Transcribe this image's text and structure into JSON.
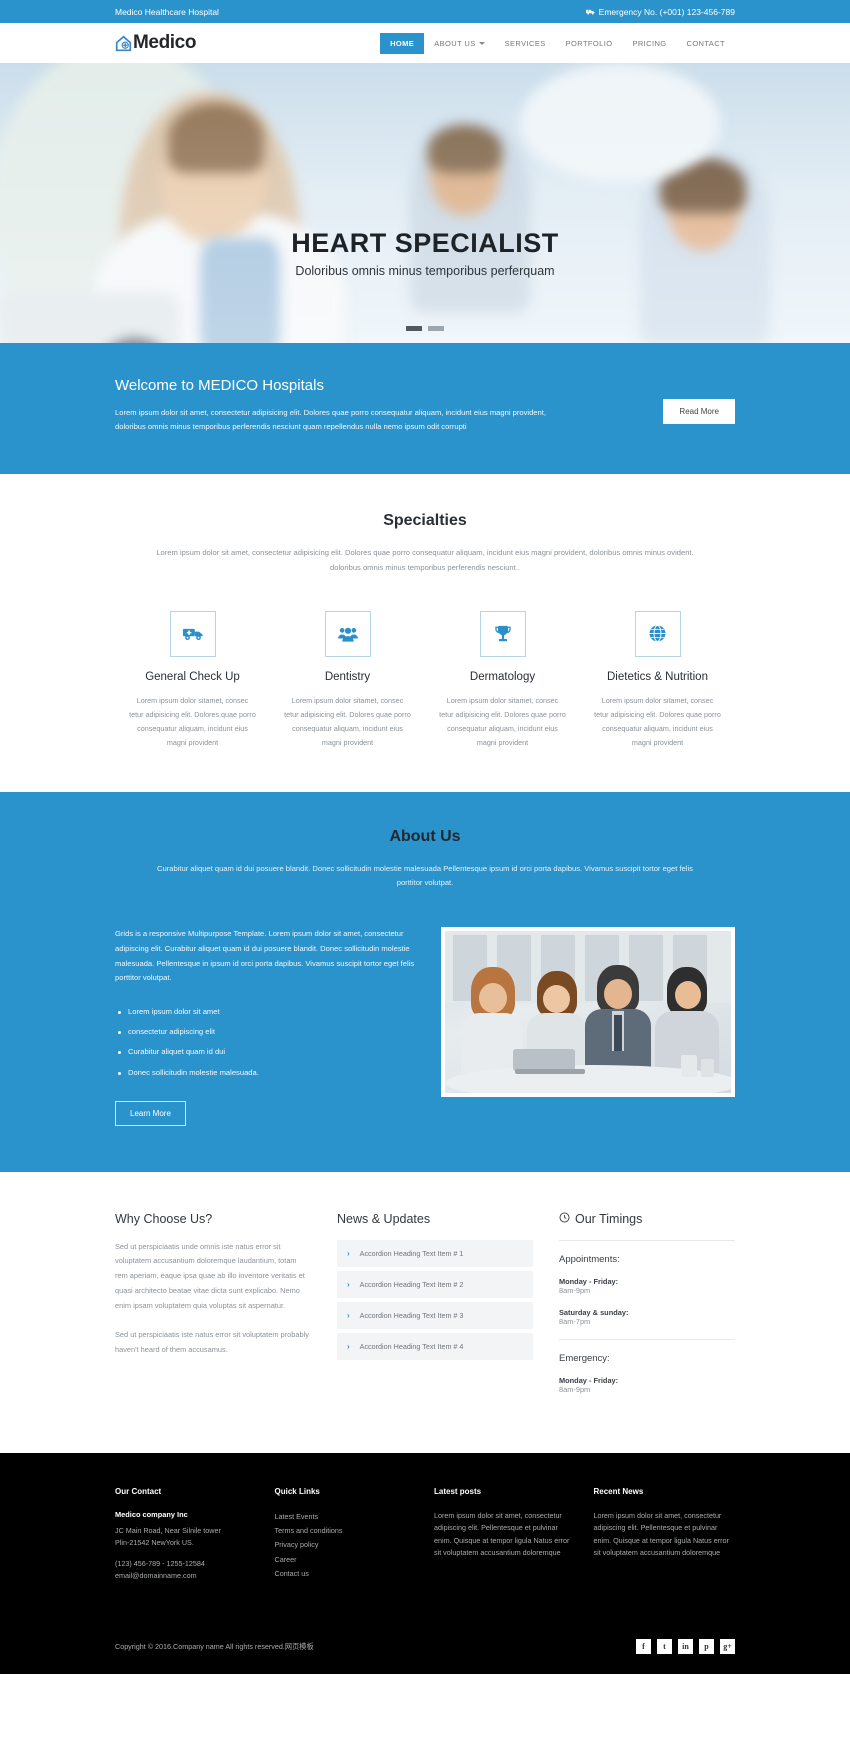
{
  "topbar": {
    "site_name": "Medico Healthcare Hospital",
    "emergency": "Emergency No. (+001) 123-456-789",
    "emergency_icon": "ambulance-icon"
  },
  "header": {
    "logo_text": "Medico",
    "logo_icon": "home-medical-icon",
    "nav": [
      {
        "label": "HOME",
        "active": true,
        "caret": false
      },
      {
        "label": "ABOUT US",
        "active": false,
        "caret": true
      },
      {
        "label": "SERVICES",
        "active": false,
        "caret": false
      },
      {
        "label": "PORTFOLIO",
        "active": false,
        "caret": false
      },
      {
        "label": "PRICING",
        "active": false,
        "caret": false
      },
      {
        "label": "CONTACT",
        "active": false,
        "caret": false
      }
    ]
  },
  "hero": {
    "title": "HEART SPECIALIST",
    "subtitle": "Doloribus omnis minus temporibus perferquam",
    "slides": 2,
    "active_slide": 1
  },
  "welcome": {
    "title": "Welcome to MEDICO Hospitals",
    "text": "Lorem ipsum dolor sit amet, consectetur adipisicing elit. Dolores quae porro consequatur aliquam, incidunt eius magni provident, doloribus omnis minus temporibus perferendis nesciunt quam repellendus nulla nemo ipsum odit corrupti",
    "button": "Read More",
    "bg_color": "#2b93cc"
  },
  "specialties": {
    "title": "Specialties",
    "subtitle": "Lorem ipsum dolor sit amet, consectetur adipisicing elit. Dolores quae porro consequatur aliquam, incidunt eius magni provident, doloribus omnis minus ovident. doloribus omnis minus temporibus perferendis nesciunt..",
    "items": [
      {
        "icon": "ambulance-icon",
        "title": "General Check Up",
        "text": "Lorem ipsum dolor sitamet, consec tetur adipisicing elit. Dolores quae porro consequatur aliquam, incidunt eius magni provident"
      },
      {
        "icon": "group-people-icon",
        "title": "Dentistry",
        "text": "Lorem ipsum dolor sitamet, consec tetur adipisicing elit. Dolores quae porro consequatur aliquam, incidunt eius magni provident"
      },
      {
        "icon": "trophy-icon",
        "title": "Dermatology",
        "text": "Lorem ipsum dolor sitamet, consec tetur adipisicing elit. Dolores quae porro consequatur aliquam, incidunt eius magni provident"
      },
      {
        "icon": "globe-icon",
        "title": "Dietetics & Nutrition",
        "text": "Lorem ipsum dolor sitamet, consec tetur adipisicing elit. Dolores quae porro consequatur aliquam, incidunt eius magni provident"
      }
    ]
  },
  "about": {
    "title": "About Us",
    "subtitle": "Curabitur aliquet quam id dui posuere blandit. Donec sollicitudin molestie malesuada Pellentesque ipsum id orci porta dapibus. Vivamus suscipit tortor eget felis porttitor volutpat.",
    "body": "Grids is a responsive Multipurpose Template. Lorem ipsum dolor sit amet, consectetur adipiscing elit. Curabitur aliquet quam id dui posuere blandit. Donec sollicitudin molestie malesuada. Pellentesque in ipsum id orci porta dapibus. Vivamus suscipit tortor eget felis porttitor volutpat.",
    "list": [
      "Lorem ipsum dolor sit amet",
      "consectetur adipiscing elit",
      "Curabitur aliquet quam id dui",
      "Donec sollicitudin molestie malesuada."
    ],
    "button": "Learn More",
    "image_alt": "business-team-meeting-photo"
  },
  "why_choose": {
    "title": "Why Choose Us?",
    "paragraphs": [
      "Sed ut perspiciaatis unde omnis iste natus error sit voluptatem accusantium doloremque laudantium, totam rem aperiam, eaque ipsa quae ab illo inventore veritatis et quasi architecto beatae vitae dicta sunt explicabo. Nemo enim ipsam voluptatem quia voluptas sit aspernatur.",
      "Sed ut perspiciaatis iste natus error sit voluptatem probably haven't heard of them accusamus."
    ]
  },
  "news": {
    "title": "News & Updates",
    "items": [
      "Accordion Heading Text Item # 1",
      "Accordion Heading Text Item # 2",
      "Accordion Heading Text Item # 3",
      "Accordion Heading Text Item # 4"
    ],
    "chevron_icon": "chevron-right-icon"
  },
  "timings": {
    "title": "Our Timings",
    "clock_icon": "clock-icon",
    "groups": [
      {
        "heading": "Appointments:",
        "rows": [
          {
            "day": "Monday - Friday:",
            "hours": "8am-9pm"
          },
          {
            "day": "Saturday & sunday:",
            "hours": "8am-7pm"
          }
        ]
      },
      {
        "heading": "Emergency:",
        "rows": [
          {
            "day": "Monday - Friday:",
            "hours": "8am-9pm"
          }
        ]
      }
    ]
  },
  "footer": {
    "contact": {
      "title": "Our Contact",
      "company": "Medico company Inc",
      "address_line1": "JC Main Road, Near Silnile tower",
      "address_line2": "Plin-21542 NewYork US.",
      "phone": "(123) 456-789 - 1255-12584",
      "email": "email@domainname.com"
    },
    "quick_links": {
      "title": "Quick Links",
      "links": [
        "Latest Events",
        "Terms and conditions",
        "Privacy policy",
        "Career",
        "Contact us"
      ]
    },
    "latest_posts": {
      "title": "Latest posts",
      "text": "Lorem ipsum dolor sit amet, consectetur adipiscing elit. Pellentesque et pulvinar enim. Quisque at tempor ligula Natus error sit voluptatem accusantium doloremque"
    },
    "recent_news": {
      "title": "Recent News",
      "text": "Lorem ipsum dolor sit amet, consectetur adipiscing elit. Pellentesque et pulvinar enim. Quisque at tempor ligula Natus error sit voluptatem accusantium doloremque"
    },
    "copyright": "Copyright © 2016.Company name All rights reserved.网页模板",
    "socials": [
      {
        "name": "facebook-icon",
        "glyph": "f"
      },
      {
        "name": "twitter-icon",
        "glyph": "t"
      },
      {
        "name": "linkedin-icon",
        "glyph": "in"
      },
      {
        "name": "pinterest-icon",
        "glyph": "p"
      },
      {
        "name": "googleplus-icon",
        "glyph": "g+"
      }
    ]
  }
}
